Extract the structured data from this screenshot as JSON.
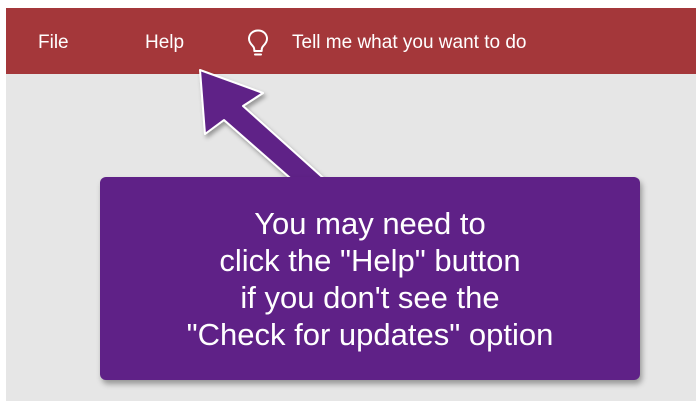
{
  "ribbon": {
    "background_color": "#a4373a",
    "menu": {
      "file_label": "File",
      "help_label": "Help"
    },
    "tell_me": {
      "icon": "lightbulb-icon",
      "label": "Tell me what you want to do"
    }
  },
  "workspace": {
    "background_color": "#e6e6e6"
  },
  "callout": {
    "background_color": "#5f2187",
    "arrow_target": "Help",
    "lines": [
      "You may need to",
      "click the \"Help\" button",
      "if you don't see the",
      "\"Check for updates\" option"
    ]
  }
}
